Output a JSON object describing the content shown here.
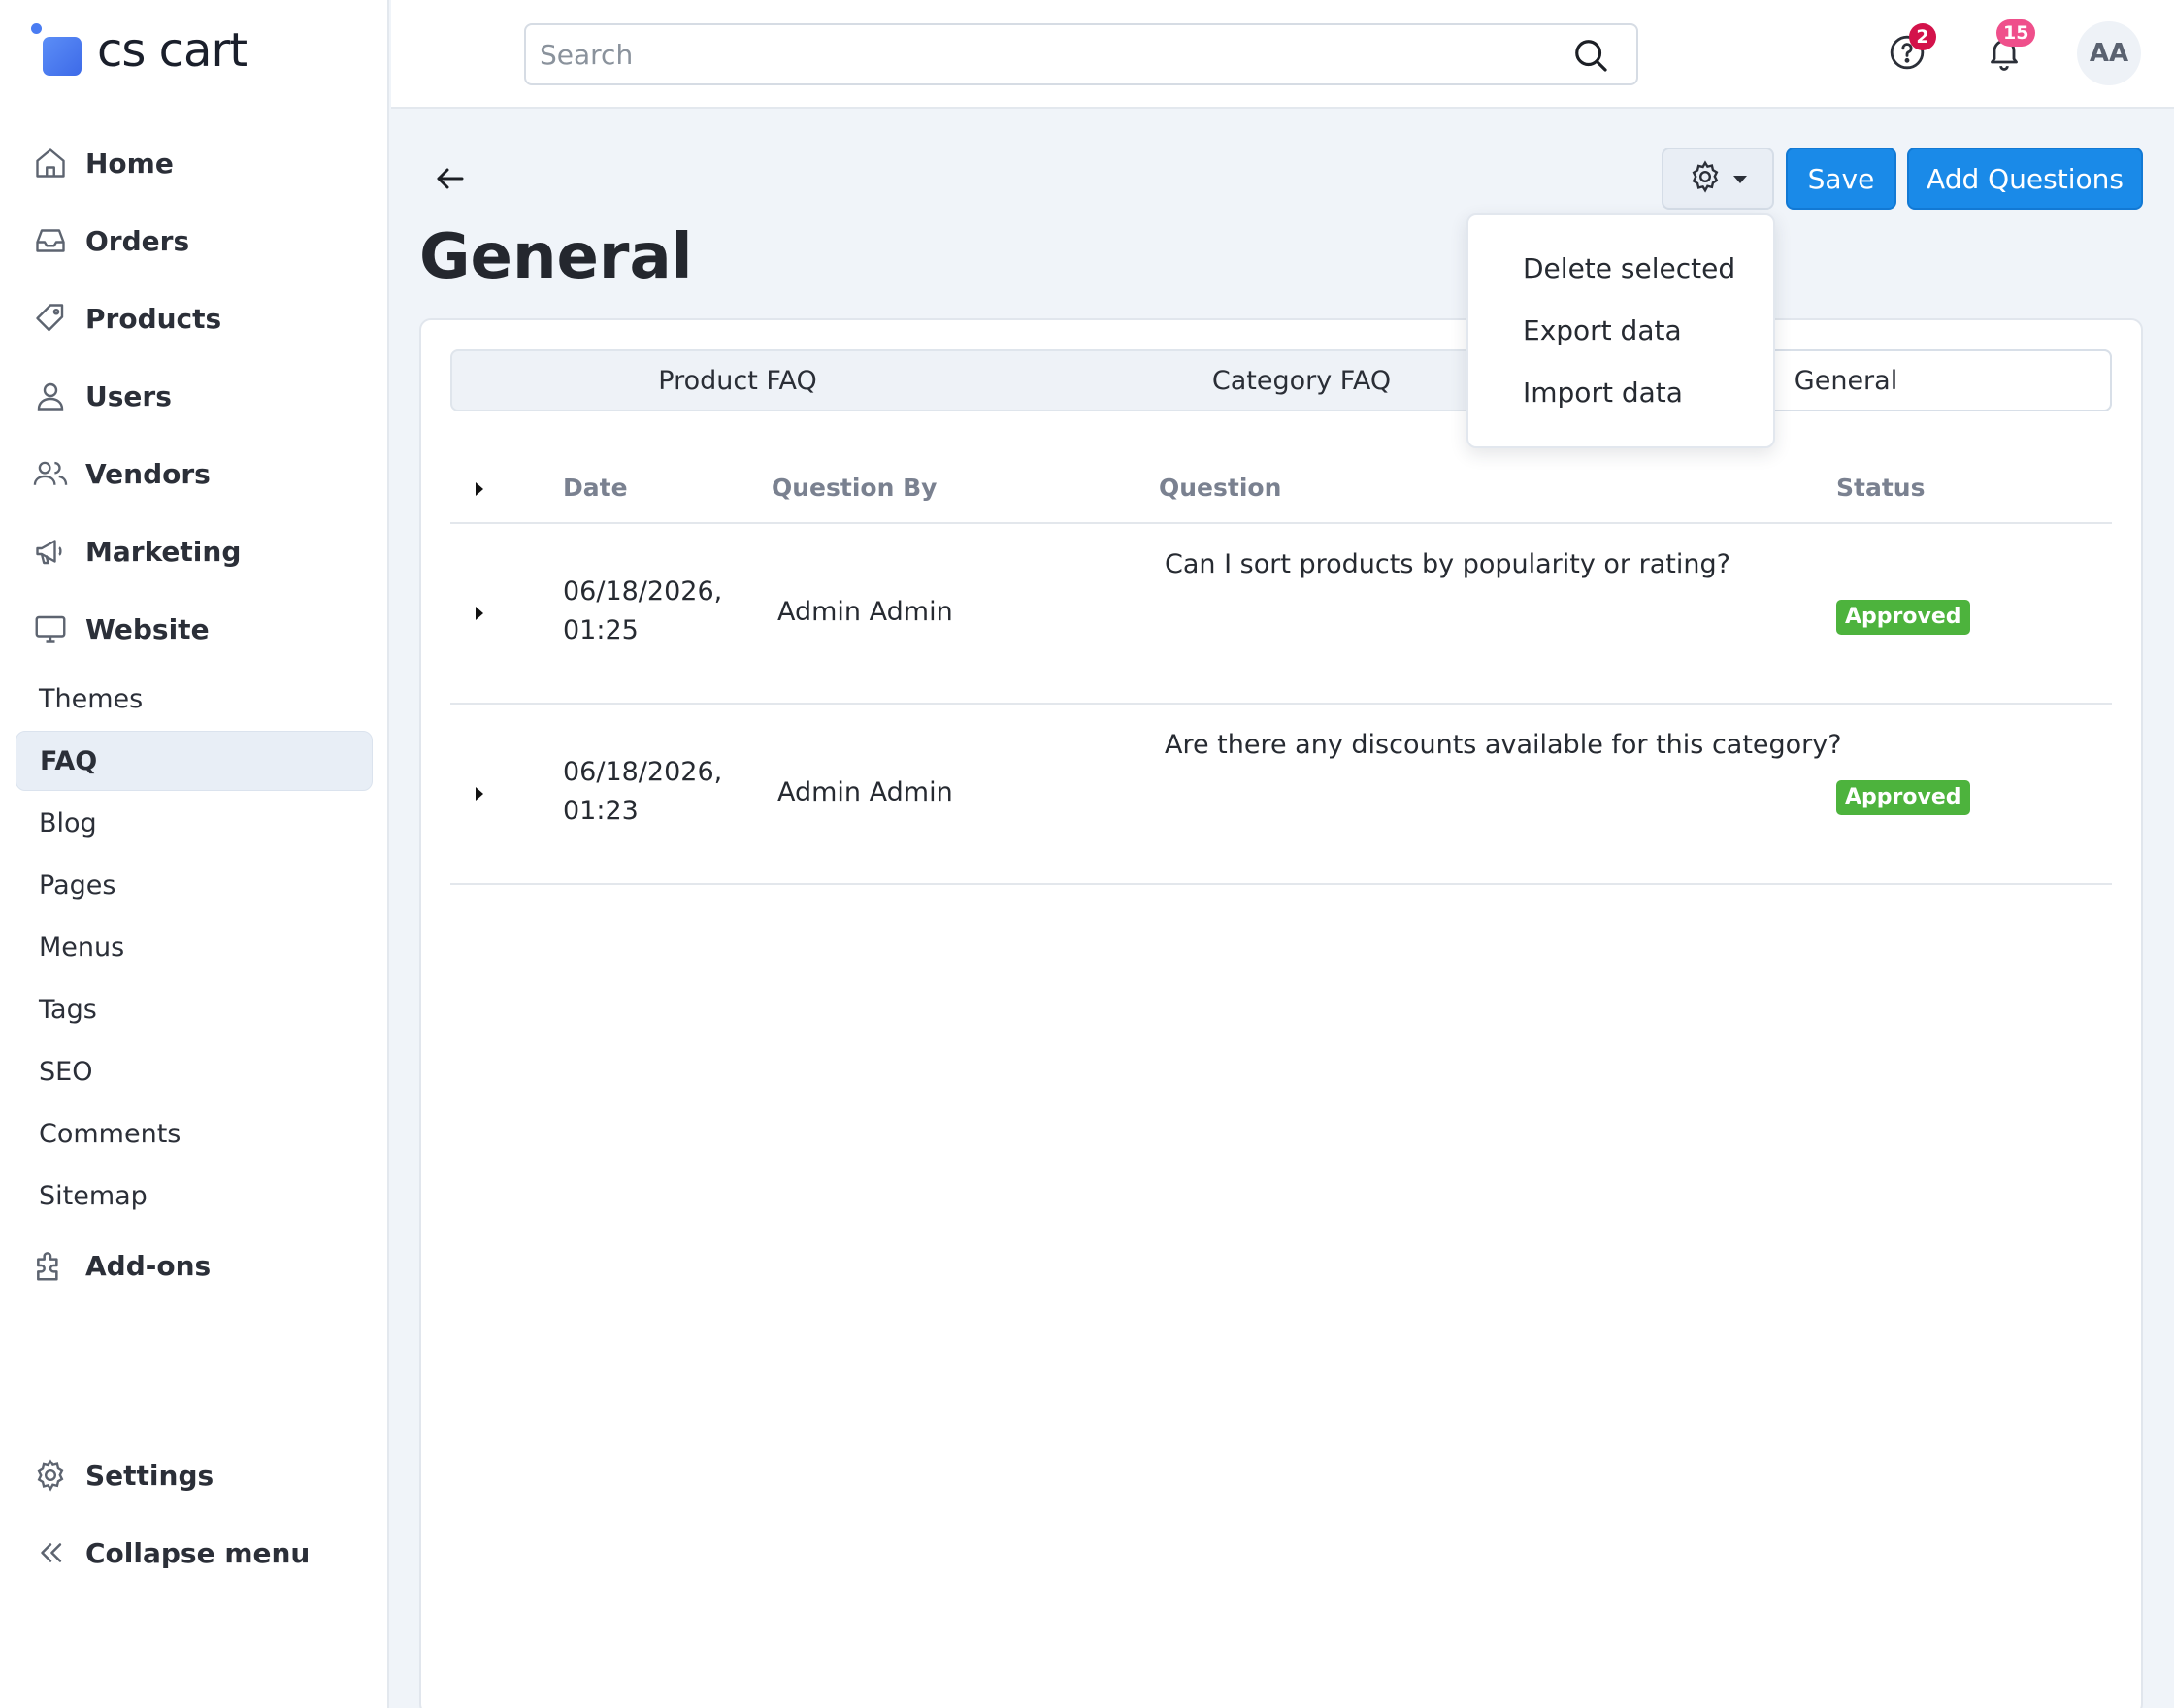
{
  "brand": {
    "name": "cs cart"
  },
  "search": {
    "placeholder": "Search"
  },
  "topbar": {
    "help_badge": "2",
    "notifications_badge": "15",
    "avatar_initials": "AA"
  },
  "sidebar": {
    "main_items": [
      {
        "label": "Home",
        "icon": "home-icon"
      },
      {
        "label": "Orders",
        "icon": "inbox-icon"
      },
      {
        "label": "Products",
        "icon": "tag-icon"
      },
      {
        "label": "Users",
        "icon": "user-icon"
      },
      {
        "label": "Vendors",
        "icon": "users-icon"
      },
      {
        "label": "Marketing",
        "icon": "megaphone-icon"
      },
      {
        "label": "Website",
        "icon": "monitor-icon"
      }
    ],
    "website_sub_items": [
      "Themes",
      "FAQ",
      "Blog",
      "Pages",
      "Menus",
      "Tags",
      "SEO",
      "Comments",
      "Sitemap"
    ],
    "active_sub_item": "FAQ",
    "addons_label": "Add-ons",
    "settings_label": "Settings",
    "collapse_label": "Collapse menu"
  },
  "page": {
    "title": "General",
    "save_label": "Save",
    "add_label": "Add Questions"
  },
  "tabs": [
    {
      "label": "Product FAQ",
      "active": false
    },
    {
      "label": "Category FAQ",
      "active": false
    },
    {
      "label": "General",
      "active": true
    }
  ],
  "dropdown": {
    "items": [
      "Delete selected",
      "Export data",
      "Import data"
    ]
  },
  "table": {
    "columns": [
      "Date",
      "Question By",
      "Question",
      "Status"
    ],
    "rows": [
      {
        "date_line1": "06/18/2026,",
        "date_line2": "01:25",
        "question_by": "Admin Admin",
        "question": "Can I sort products by popularity or rating?",
        "status": "Approved"
      },
      {
        "date_line1": "06/18/2026,",
        "date_line2": "01:23",
        "question_by": "Admin Admin",
        "question": "Are there any discounts available for this category?",
        "status": "Approved"
      }
    ]
  },
  "colors": {
    "primary": "#1a8ae8",
    "approved": "#4db33d",
    "badge_red": "#d3124a",
    "badge_pink": "#ef4f8b"
  }
}
